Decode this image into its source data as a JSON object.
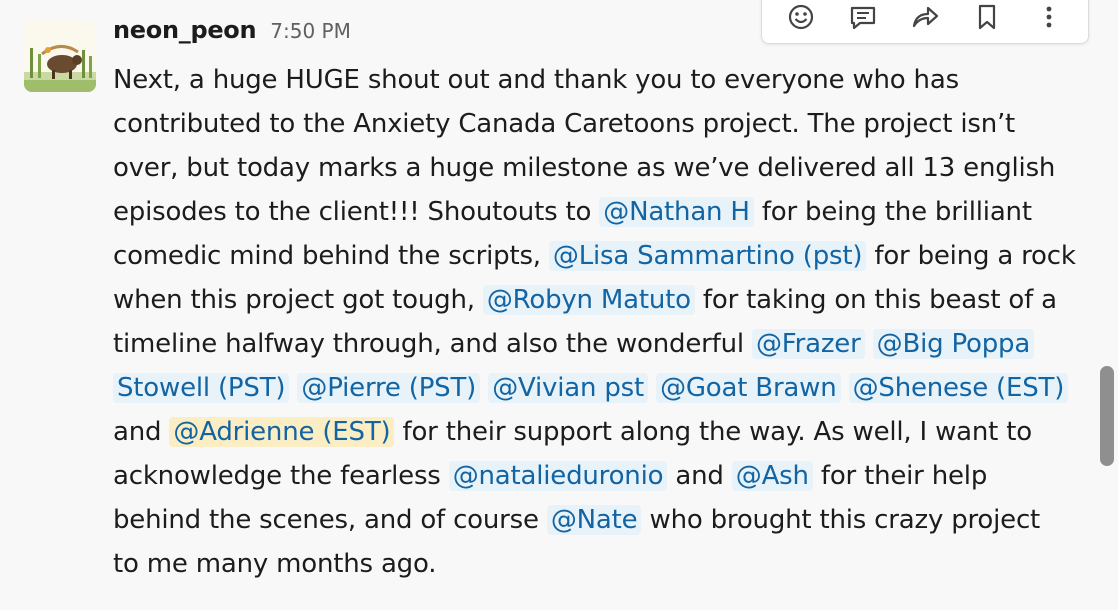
{
  "message": {
    "username": "neon_peon",
    "timestamp": "7:50 PM",
    "lines": [
      [
        {
          "t": "Next, a huge HUGE shout out and thank you to everyone who has"
        }
      ],
      [
        {
          "t": "contributed to the Anxiety Canada Caretoons project. The project isn’t"
        }
      ],
      [
        {
          "t": "over, but today marks a huge milestone as we’ve delivered all 13 english"
        }
      ],
      [
        {
          "t": "episodes to the client!!! Shoutouts to "
        },
        {
          "m": "@Nathan H"
        },
        {
          "t": " for being the brilliant"
        }
      ],
      [
        {
          "t": "comedic mind behind the scripts, "
        },
        {
          "m": "@Lisa Sammartino (pst)"
        },
        {
          "t": " for being a rock"
        }
      ],
      [
        {
          "t": "when this project got tough, "
        },
        {
          "m": "@Robyn Matuto"
        },
        {
          "t": " for taking on this beast of a"
        }
      ],
      [
        {
          "t": "timeline halfway through, and also the wonderful "
        },
        {
          "m": "@Frazer"
        },
        {
          "t": " "
        },
        {
          "m": "@Big Poppa"
        }
      ],
      [
        {
          "m": "Stowell (PST)"
        },
        {
          "t": " "
        },
        {
          "m": "@Pierre (PST)"
        },
        {
          "t": " "
        },
        {
          "m": "@Vivian pst"
        },
        {
          "t": " "
        },
        {
          "m": "@Goat Brawn"
        },
        {
          "t": " "
        },
        {
          "m": "@Shenese (EST)"
        }
      ],
      [
        {
          "t": "and "
        },
        {
          "m": "@Adrienne (EST)",
          "self": true
        },
        {
          "t": " for their support along the way. As well, I want to"
        }
      ],
      [
        {
          "t": "acknowledge the fearless "
        },
        {
          "m": "@natalieduronio"
        },
        {
          "t": " and "
        },
        {
          "m": "@Ash"
        },
        {
          "t": " for their help"
        }
      ],
      [
        {
          "t": "behind the scenes, and of course "
        },
        {
          "m": "@Nate"
        },
        {
          "t": " who brought this crazy project"
        }
      ],
      [
        {
          "t": "to me many months ago."
        }
      ]
    ]
  },
  "toolbar": {
    "buttons": [
      {
        "name": "add-reaction-button",
        "icon": "emoji-icon"
      },
      {
        "name": "reply-in-thread-button",
        "icon": "thread-icon"
      },
      {
        "name": "share-message-button",
        "icon": "share-icon"
      },
      {
        "name": "save-message-button",
        "icon": "bookmark-icon"
      },
      {
        "name": "more-actions-button",
        "icon": "more-icon"
      }
    ]
  },
  "colors": {
    "mention_text": "#1264a3",
    "mention_bg": "#e8f2f9",
    "self_mention_bg": "#fbedc4",
    "background": "#f8f8f8"
  }
}
